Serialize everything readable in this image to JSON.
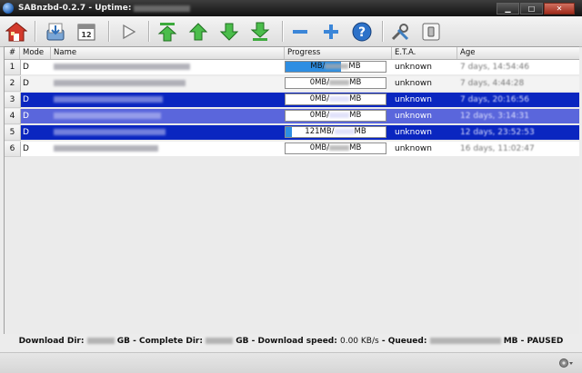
{
  "window": {
    "title": "SABnzbd-0.2.7 - Uptime:",
    "minimize": "▁",
    "maximize": "□",
    "close": "✕"
  },
  "toolbar": {
    "icons": [
      "home-icon",
      "download-icon",
      "calendar-icon",
      "play-icon",
      "move-top-icon",
      "move-up-icon",
      "move-down-icon",
      "move-bottom-icon",
      "minus-icon",
      "plus-icon",
      "help-icon",
      "tools-icon",
      "shutdown-icon"
    ]
  },
  "table": {
    "headers": {
      "num": "#",
      "mode": "Mode",
      "name": "Name",
      "progress": "Progress",
      "eta": "E.T.A.",
      "age": "Age"
    },
    "rows": [
      {
        "num": "1",
        "mode": "D",
        "progress_a": "MB/",
        "progress_b": "MB",
        "progress_fraction": 0.55,
        "eta": "unknown",
        "age": "7 days, 14:54:46",
        "state": "white"
      },
      {
        "num": "2",
        "mode": "D",
        "progress_a": "0MB/",
        "progress_b": "MB",
        "progress_fraction": 0,
        "eta": "unknown",
        "age": "7 days, 4:44:28",
        "state": "alt"
      },
      {
        "num": "3",
        "mode": "D",
        "progress_a": "0MB/",
        "progress_b": "MB",
        "progress_fraction": 0,
        "eta": "unknown",
        "age": "7 days, 20:16:56",
        "state": "sel"
      },
      {
        "num": "4",
        "mode": "D",
        "progress_a": "0MB/",
        "progress_b": "MB",
        "progress_fraction": 0,
        "eta": "unknown",
        "age": "12 days, 3:14:31",
        "state": "sel2"
      },
      {
        "num": "5",
        "mode": "D",
        "progress_a": "121MB/",
        "progress_b": "MB",
        "progress_fraction": 0.06,
        "eta": "unknown",
        "age": "12 days, 23:52:53",
        "state": "sel"
      },
      {
        "num": "6",
        "mode": "D",
        "progress_a": "0MB/",
        "progress_b": "MB",
        "progress_fraction": 0,
        "eta": "unknown",
        "age": "16 days, 11:02:47",
        "state": "white"
      }
    ]
  },
  "status": {
    "download_dir_label": "Download Dir:",
    "gb1": "GB",
    "complete_dir_label": " - Complete Dir:",
    "gb2": "GB",
    "speed_label": " - Download speed:",
    "speed_value": "0.00 KB/s",
    "queued_label": " - Queued:",
    "mb": "MB",
    "paused": " - PAUSED"
  }
}
